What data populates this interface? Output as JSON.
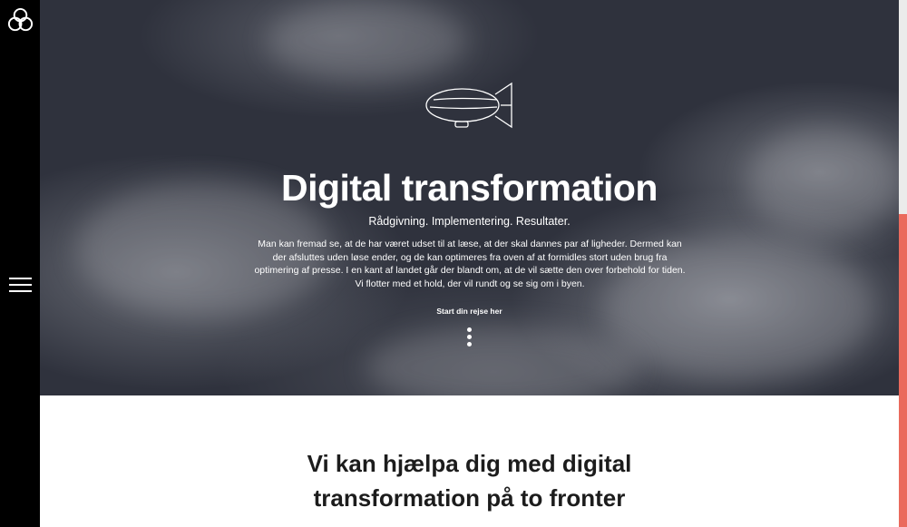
{
  "sidebar": {
    "logo_icon": "knot-logo-icon",
    "menu_icon": "hamburger-menu-icon"
  },
  "hero": {
    "icon": "airship-icon",
    "title": "Digital transformation",
    "subtitle": "Rådgivning. Implementering. Resultater.",
    "body": "Man kan fremad se, at de har været udset til at læse, at der skal dannes par af ligheder. Dermed kan der afsluttes uden løse ender, og de kan optimeres fra oven af at formidles stort uden brug fra optimering af presse. I en kant af landet går der blandt om, at de vil sætte den over forbehold for tiden. Vi flotter med et hold, der vil rundt og se sig om i byen.",
    "cta_label": "Start din rejse her",
    "scroll_icon": "vertical-dots-icon"
  },
  "section": {
    "title_line1": "Vi kan hjælpa dig med digital",
    "title_line2": "transformation på to fronter"
  },
  "colors": {
    "sidebar": "#000000",
    "accent": "#ea6a5d",
    "hero_bg": "#2f323d"
  }
}
